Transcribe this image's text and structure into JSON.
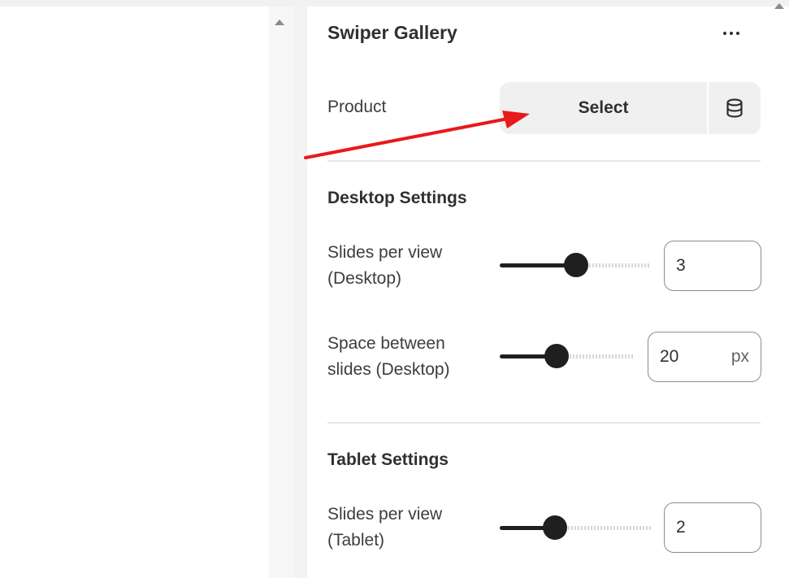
{
  "panel": {
    "title": "Swiper Gallery",
    "more_icon": "more-horizontal-icon"
  },
  "product": {
    "label": "Product",
    "select_label": "Select",
    "source_icon": "database-icon"
  },
  "desktop": {
    "section_title": "Desktop Settings",
    "slides_per_view": {
      "label_line1": "Slides per view",
      "label_line2": "(Desktop)",
      "value": "3"
    },
    "space_between": {
      "label_line1": "Space between",
      "label_line2": "slides (Desktop)",
      "value": "20",
      "unit": "px"
    }
  },
  "tablet": {
    "section_title": "Tablet Settings",
    "slides_per_view": {
      "label_line1": "Slides per view",
      "label_line2": "(Tablet)",
      "value": "2"
    }
  },
  "colors": {
    "annotation_arrow": "#e8191a",
    "slider_fill": "#1f1f1f",
    "select_bg": "#f0f0f0"
  }
}
